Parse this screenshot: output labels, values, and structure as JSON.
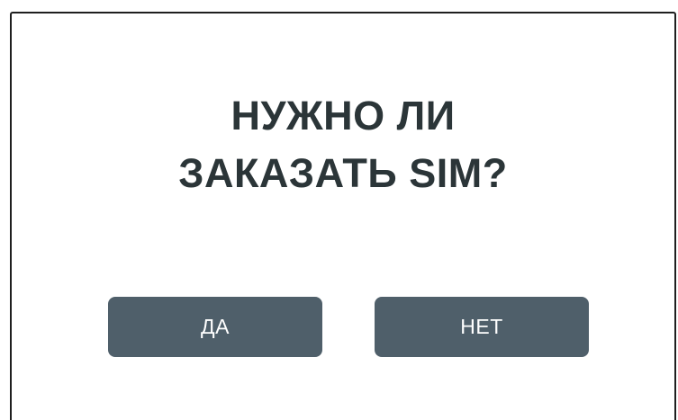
{
  "dialog": {
    "title_line1": "НУЖНО ЛИ",
    "title_line2": "ЗАКАЗАТЬ SIM?",
    "yes_label": "ДА",
    "no_label": "НЕТ"
  },
  "colors": {
    "button_bg": "#4f5f6a",
    "title_text": "#2b3538",
    "button_text": "#ffffff",
    "border": "#1f1f1f"
  }
}
